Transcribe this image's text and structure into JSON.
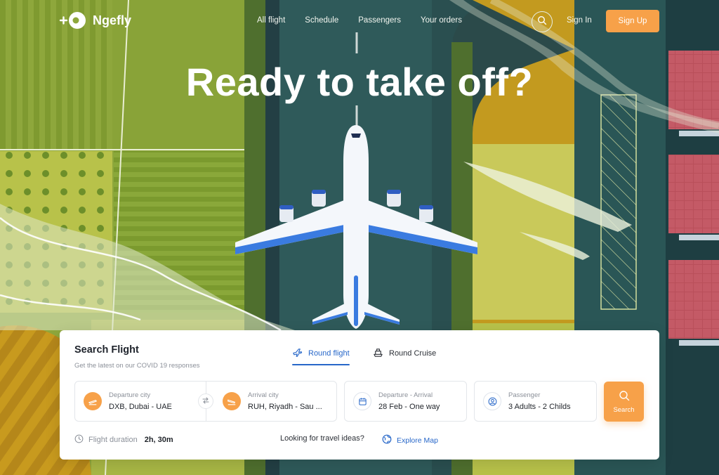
{
  "brand": {
    "name": "Ngefly"
  },
  "nav": {
    "links": [
      "All flight",
      "Schedule",
      "Passengers",
      "Your orders"
    ],
    "sign_in": "Sign In",
    "sign_up": "Sign Up"
  },
  "hero": {
    "title": "Ready to take off?"
  },
  "search": {
    "title": "Search Flight",
    "subtitle": "Get the latest on our COVID 19 responses",
    "tabs": [
      {
        "label": "Round flight",
        "icon": "plane-icon",
        "active": true
      },
      {
        "label": "Round Cruise",
        "icon": "ship-icon",
        "active": false
      }
    ],
    "departure": {
      "label": "Departure city",
      "value": "DXB, Dubai - UAE"
    },
    "arrival": {
      "label": "Arrival city",
      "value": "RUH, Riyadh - Sau ..."
    },
    "dates": {
      "label": "Departure - Arrival",
      "value": "28 Feb - One way"
    },
    "passenger": {
      "label": "Passenger",
      "value": "3 Adults - 2 Childs"
    },
    "button": "Search",
    "duration_label": "Flight duration",
    "duration_value": "2h, 30m",
    "ideas_text": "Looking for travel ideas?",
    "explore_label": "Explore Map"
  },
  "colors": {
    "accent": "#f7a149",
    "link_blue": "#2767c9",
    "field_green": "#8ea73c",
    "runway_teal": "#2f5a5a",
    "dark_teal": "#1e3e42",
    "roof_red": "#b54a56"
  }
}
